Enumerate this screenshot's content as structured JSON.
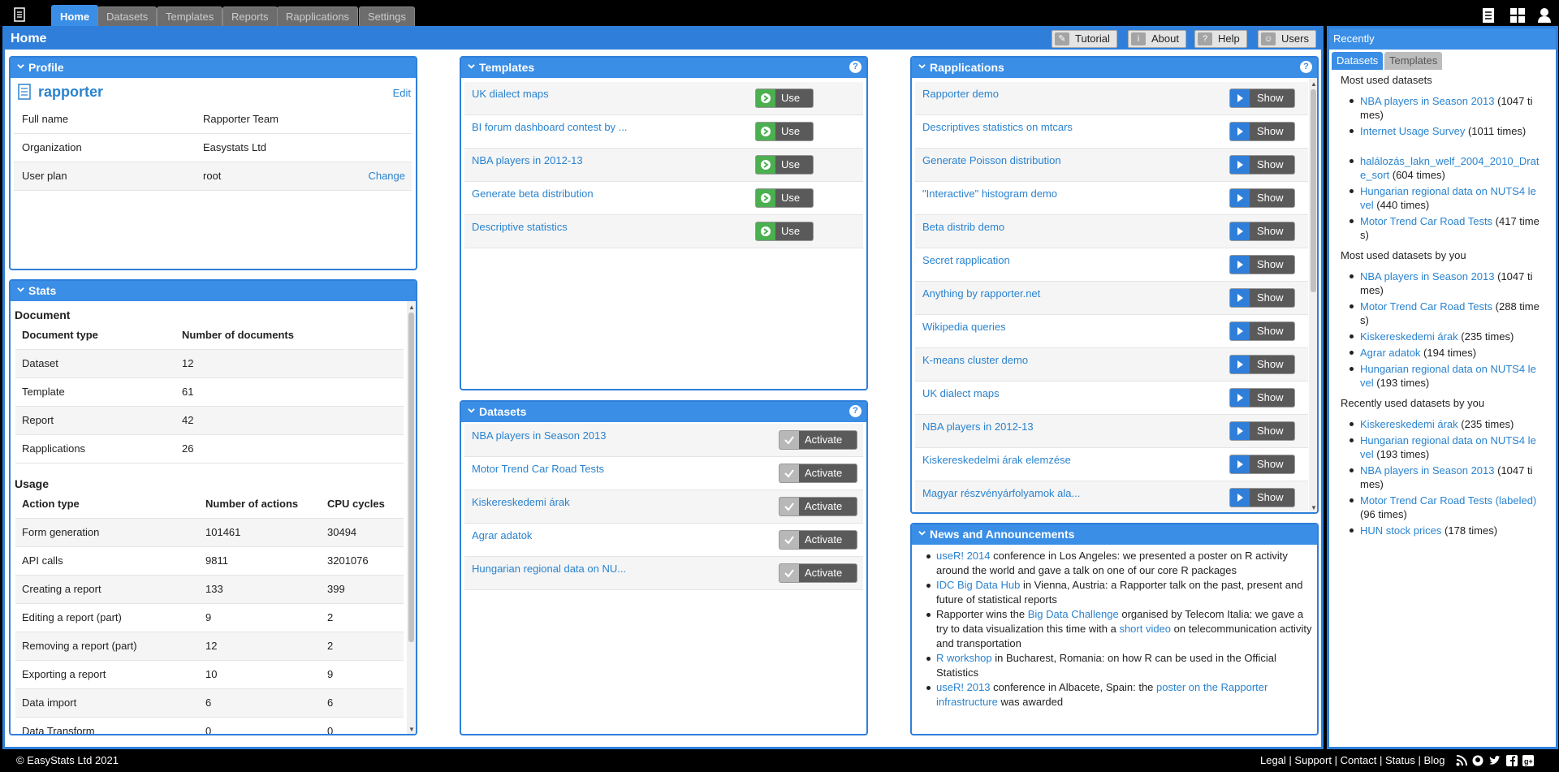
{
  "nav": {
    "tabs": [
      {
        "label": "Home",
        "active": true
      },
      {
        "label": "Datasets"
      },
      {
        "label": "Templates"
      },
      {
        "label": "Reports"
      },
      {
        "label": "Rapplications"
      },
      {
        "label": "Settings"
      }
    ]
  },
  "main": {
    "title": "Home",
    "buttons": [
      {
        "label": "Tutorial",
        "icon": "pencil-icon"
      },
      {
        "label": "About",
        "icon": "info-icon"
      },
      {
        "label": "Help",
        "icon": "question-icon"
      },
      {
        "label": "Users",
        "icon": "users-icon"
      }
    ]
  },
  "profile": {
    "title": "Profile",
    "username": "rapporter",
    "edit": "Edit",
    "rows": [
      {
        "label": "Full name",
        "value": "Rapporter Team"
      },
      {
        "label": "Organization",
        "value": "Easystats Ltd"
      },
      {
        "label": "User plan",
        "value": "root",
        "action": "Change"
      }
    ]
  },
  "stats": {
    "title": "Stats",
    "document_heading": "Document",
    "document_columns": [
      "Document type",
      "Number of documents"
    ],
    "documents": [
      [
        "Dataset",
        "12"
      ],
      [
        "Template",
        "61"
      ],
      [
        "Report",
        "42"
      ],
      [
        "Rapplications",
        "26"
      ]
    ],
    "usage_heading": "Usage",
    "usage_columns": [
      "Action type",
      "Number of actions",
      "CPU cycles"
    ],
    "usage": [
      [
        "Form generation",
        "101461",
        "30494"
      ],
      [
        "API calls",
        "9811",
        "3201076"
      ],
      [
        "Creating a report",
        "133",
        "399"
      ],
      [
        "Editing a report (part)",
        "9",
        "2"
      ],
      [
        "Removing a report (part)",
        "12",
        "2"
      ],
      [
        "Exporting a report",
        "10",
        "9"
      ],
      [
        "Data import",
        "6",
        "6"
      ],
      [
        "Data Transform",
        "0",
        "0"
      ]
    ]
  },
  "templates": {
    "title": "Templates",
    "button_label": "Use",
    "items": [
      "UK dialect maps",
      "BI forum dashboard contest by ...",
      "NBA players in 2012-13",
      "Generate beta distribution",
      "Descriptive statistics"
    ]
  },
  "datasets": {
    "title": "Datasets",
    "button_label": "Activate",
    "items": [
      "NBA players in Season 2013",
      "Motor Trend Car Road Tests",
      "Kiskereskedemi árak",
      "Agrar adatok",
      "Hungarian regional data on NU..."
    ]
  },
  "rapplications": {
    "title": "Rapplications",
    "button_label": "Show",
    "items": [
      "Rapporter demo",
      "Descriptives statistics on mtcars",
      "Generate Poisson distribution",
      "\"Interactive\" histogram demo",
      "Beta distrib demo",
      "Secret rapplication",
      "Anything by rapporter.net",
      "Wikipedia queries",
      "K-means cluster demo",
      "UK dialect maps",
      "NBA players in 2012-13",
      "Kiskereskedelmi árak elemzése",
      "Magyar részvényárfolyamok ala..."
    ]
  },
  "news": {
    "title": "News and Announcements",
    "items": [
      {
        "link": "useR! 2014",
        "text": " conference in Los Angeles: we presented a poster on R activity around the world and gave a talk on one of our core R packages"
      },
      {
        "link": "IDC Big Data Hub",
        "text": " in Vienna, Austria: a Rapporter talk on the past, present and future of statistical reports"
      },
      {
        "pre": "Rapporter wins the ",
        "link": "Big Data Challenge",
        "mid": " organised by Telecom Italia: we gave a try to data visualization this time with a ",
        "link2": "short video",
        "text": " on telecommunication activity and transportation"
      },
      {
        "link": "R workshop",
        "text": " in Bucharest, Romania: on how R can be used in the Official Statistics"
      },
      {
        "link": "useR! 2013",
        "mid": " conference in Albacete, Spain: the ",
        "link2": "poster on the Rapporter infrastructure",
        "text": " was awarded"
      }
    ]
  },
  "recent": {
    "title": "Recently",
    "tabs": [
      "Datasets",
      "Templates"
    ],
    "sections": [
      {
        "heading": "Most used datasets",
        "items": [
          {
            "name": "NBA players in Season 2013",
            "count": " (1047 times)"
          },
          {
            "name": "Internet Usage Survey",
            "count": " (1011 times)"
          },
          {
            "name": "halálozás_lakn_welf_2004_2010_Drate_sort",
            "count": " (604 times)"
          },
          {
            "name": "Hungarian regional data on NUTS4 level",
            "count": " (440 times)"
          },
          {
            "name": "Motor Trend Car Road Tests",
            "count": " (417 times)"
          }
        ]
      },
      {
        "heading": "Most used datasets by you",
        "items": [
          {
            "name": "NBA players in Season 2013",
            "count": " (1047 times)"
          },
          {
            "name": "Motor Trend Car Road Tests",
            "count": " (288 times)"
          },
          {
            "name": "Kiskereskedemi árak",
            "count": " (235 times)"
          },
          {
            "name": "Agrar adatok",
            "count": " (194 times)"
          },
          {
            "name": "Hungarian regional data on NUTS4 level",
            "count": " (193 times)"
          }
        ]
      },
      {
        "heading": "Recently used datasets by you",
        "items": [
          {
            "name": "Kiskereskedemi árak",
            "count": " (235 times)"
          },
          {
            "name": "Hungarian regional data on NUTS4 level",
            "count": " (193 times)"
          },
          {
            "name": "NBA players in Season 2013",
            "count": " (1047 times)"
          },
          {
            "name": "Motor Trend Car Road Tests (labeled)",
            "count": " (96 times)"
          },
          {
            "name": "HUN stock prices",
            "count": " (178 times)"
          }
        ]
      }
    ]
  },
  "footer": {
    "copyright": "© EasyStats Ltd 2021",
    "links": [
      "Legal",
      "Support",
      "Contact",
      "Status",
      "Blog"
    ]
  },
  "colors": {
    "accent": "#2f7fda",
    "link": "#2a83cf",
    "use_green": "#4caf50"
  }
}
